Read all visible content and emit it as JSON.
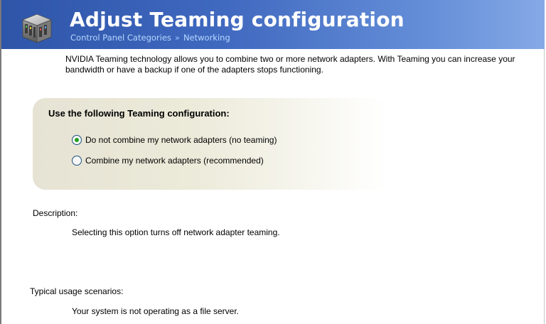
{
  "header": {
    "title": "Adjust Teaming configuration",
    "breadcrumb": {
      "parent": "Control Panel Categories",
      "separator": "»",
      "current": "Networking"
    },
    "icon": "control-panel-categories-icon"
  },
  "intro": "NVIDIA Teaming technology allows you to combine two or more network adapters. With Teaming you can increase your bandwidth or have a backup if one of the adapters stops functioning.",
  "config": {
    "heading": "Use the following Teaming configuration:",
    "options": [
      {
        "label": "Do not combine my network adapters (no teaming)",
        "selected": true
      },
      {
        "label": "Combine my network adapters (recommended)",
        "selected": false
      }
    ]
  },
  "description": {
    "label": "Description:",
    "text": "Selecting this option turns off network adapter teaming."
  },
  "usage": {
    "label": "Typical usage scenarios:",
    "text": "Your system is not operating as a file server."
  },
  "colors": {
    "header_start": "#2e55a8",
    "header_end": "#86a9e6",
    "panel": "#ecead9",
    "radio_checked": "#21a121"
  }
}
